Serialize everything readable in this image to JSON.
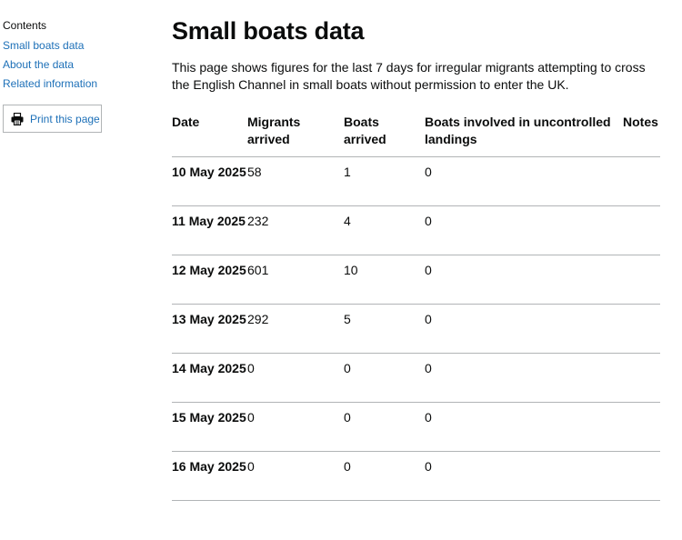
{
  "sidebar": {
    "contents_title": "Contents",
    "links": [
      {
        "label": "Small boats data"
      },
      {
        "label": "About the data"
      },
      {
        "label": "Related information"
      }
    ],
    "print_label": "Print this page",
    "print_icon": "printer-icon"
  },
  "main": {
    "title": "Small boats data",
    "lead": "This page shows figures for the last 7 days for irregular migrants attempting to cross the English Channel in small boats without permission to enter the UK."
  },
  "table": {
    "headers": [
      "Date",
      "Migrants arrived",
      "Boats arrived",
      "Boats involved in uncontrolled landings",
      "Notes"
    ],
    "rows": [
      {
        "date": "10 May 2025",
        "migrants": "58",
        "boats": "1",
        "uncontrolled": "0",
        "notes": ""
      },
      {
        "date": "11 May 2025",
        "migrants": "232",
        "boats": "4",
        "uncontrolled": "0",
        "notes": ""
      },
      {
        "date": "12 May 2025",
        "migrants": "601",
        "boats": "10",
        "uncontrolled": "0",
        "notes": ""
      },
      {
        "date": "13 May 2025",
        "migrants": "292",
        "boats": "5",
        "uncontrolled": "0",
        "notes": ""
      },
      {
        "date": "14 May 2025",
        "migrants": "0",
        "boats": "0",
        "uncontrolled": "0",
        "notes": ""
      },
      {
        "date": "15 May 2025",
        "migrants": "0",
        "boats": "0",
        "uncontrolled": "0",
        "notes": ""
      },
      {
        "date": "16 May 2025",
        "migrants": "0",
        "boats": "0",
        "uncontrolled": "0",
        "notes": ""
      }
    ]
  },
  "colors": {
    "link": "#1d70b8",
    "text": "#0b0c0c",
    "border": "#b1b4b6"
  }
}
